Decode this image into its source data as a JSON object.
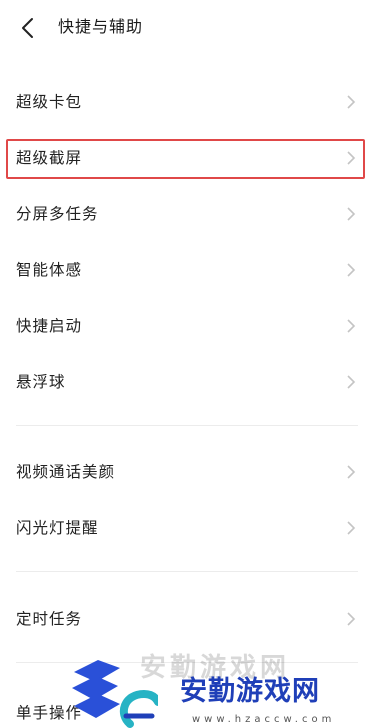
{
  "header": {
    "title": "快捷与辅助"
  },
  "items": [
    {
      "label": "超级卡包"
    },
    {
      "label": "超级截屏"
    },
    {
      "label": "分屏多任务"
    },
    {
      "label": "智能体感"
    },
    {
      "label": "快捷启动"
    },
    {
      "label": "悬浮球"
    },
    {
      "label": "视频通话美颜"
    },
    {
      "label": "闪光灯提醒"
    },
    {
      "label": "定时任务"
    },
    {
      "label": "单手操作"
    }
  ],
  "watermark": {
    "title": "安勤游戏网",
    "url": "www.hzaccw.com",
    "brand_color": "#1f3fb8"
  },
  "highlight_color": "#e04848"
}
